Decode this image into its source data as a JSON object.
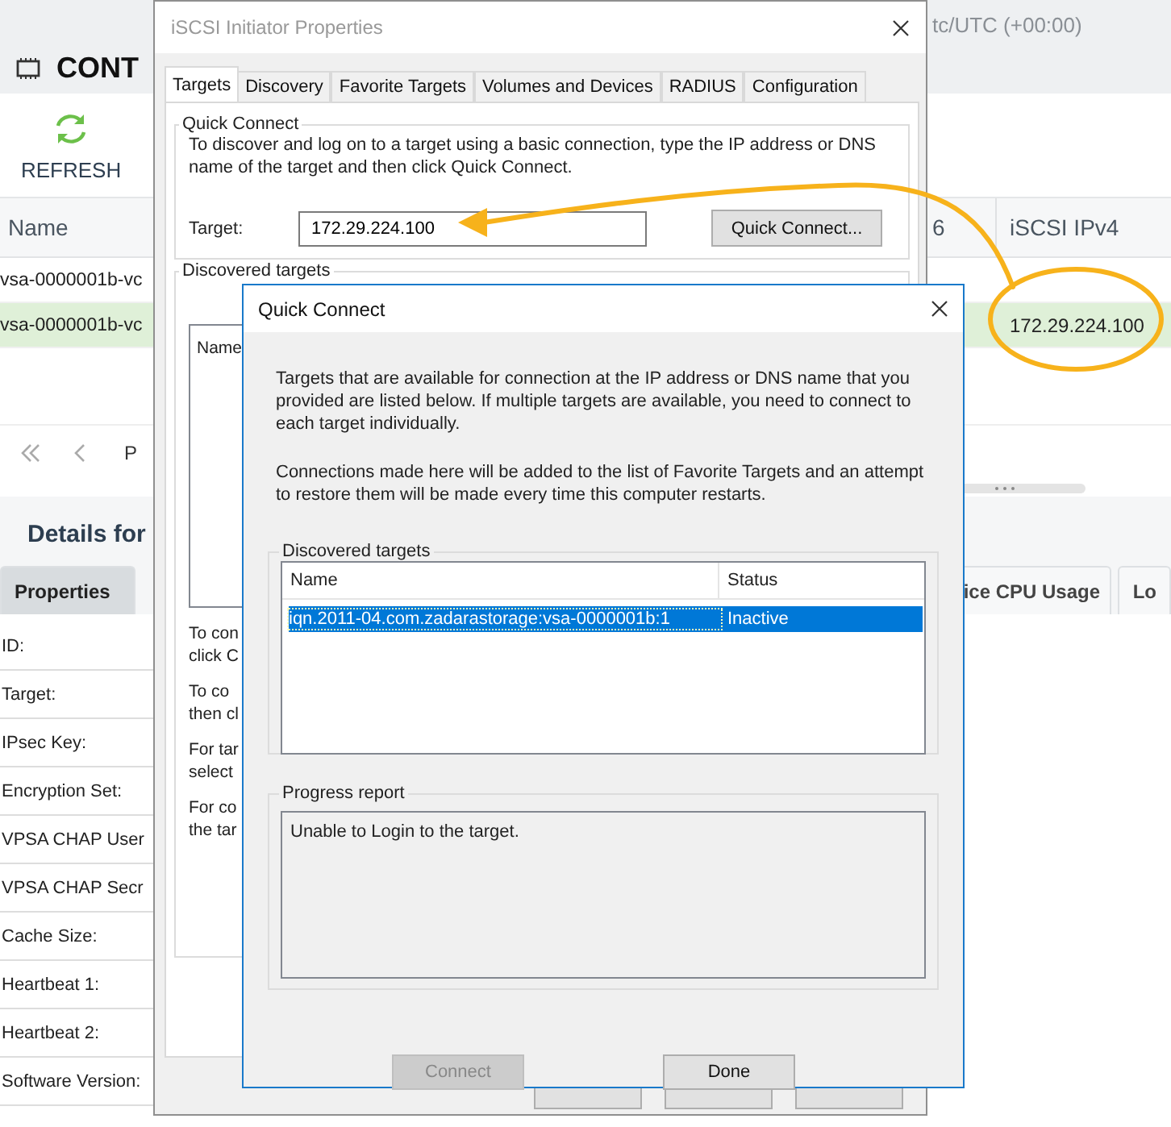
{
  "app": {
    "title": "CONT",
    "timezone": "tc/UTC (+00:00)",
    "toolbar": [
      {
        "label": "REFRESH"
      }
    ],
    "table": {
      "columns": [
        "Name",
        "6",
        "iSCSI IPv4"
      ],
      "rows": [
        {
          "name": "vsa-0000001b-vc",
          "ipv4": "",
          "selected": false
        },
        {
          "name": "vsa-0000001b-vc",
          "ipv4": "172.29.224.100",
          "selected": true
        }
      ]
    },
    "pager_text": "P",
    "details": {
      "title": "Details for",
      "tabs": [
        {
          "label": "Properties",
          "selected": true
        },
        {
          "label": "ice CPU Usage",
          "selected": false
        },
        {
          "label": "Lo",
          "selected": false
        }
      ],
      "properties": [
        "ID:",
        "Target:",
        "IPsec Key:",
        "Encryption Set:",
        "VPSA CHAP User",
        "VPSA CHAP Secr",
        "Cache Size:",
        "Heartbeat 1:",
        "Heartbeat 2:",
        "Software Version:"
      ]
    }
  },
  "iscsi_dialog": {
    "title": "iSCSI Initiator Properties",
    "tabs": [
      {
        "label": "Targets",
        "selected": true
      },
      {
        "label": "Discovery",
        "selected": false
      },
      {
        "label": "Favorite Targets",
        "selected": false
      },
      {
        "label": "Volumes and Devices",
        "selected": false
      },
      {
        "label": "RADIUS",
        "selected": false
      },
      {
        "label": "Configuration",
        "selected": false
      }
    ],
    "quick_connect": {
      "legend": "Quick Connect",
      "text": "To discover and log on to a target using a basic connection, type the IP address or DNS name of the target and then click Quick Connect.",
      "target_label": "Target:",
      "target_value": "172.29.224.100",
      "button": "Quick Connect..."
    },
    "discovered": {
      "legend": "Discovered targets",
      "list_header": "Name",
      "notes": [
        [
          "To con",
          "click C"
        ],
        [
          "To co",
          "then cl"
        ],
        [
          "For tar",
          "select"
        ],
        [
          "For co",
          "the tar"
        ]
      ]
    }
  },
  "quick_connect_dialog": {
    "title": "Quick Connect",
    "paragraphs": [
      "Targets that are available for connection at the IP address or DNS name that you provided are listed below.  If multiple targets are available, you need to connect to each target individually.",
      "Connections made here will be added to the list of Favorite Targets and an attempt to restore them will be made every time this computer restarts."
    ],
    "discovered": {
      "legend": "Discovered targets",
      "columns": [
        "Name",
        "Status"
      ],
      "rows": [
        {
          "name": "iqn.2011-04.com.zadarastorage:vsa-0000001b:1",
          "status": "Inactive",
          "selected": true
        }
      ]
    },
    "progress": {
      "legend": "Progress report",
      "text": "Unable to Login to the target."
    },
    "buttons": [
      {
        "label": "Connect",
        "disabled": true
      },
      {
        "label": "Done",
        "disabled": false
      }
    ]
  }
}
